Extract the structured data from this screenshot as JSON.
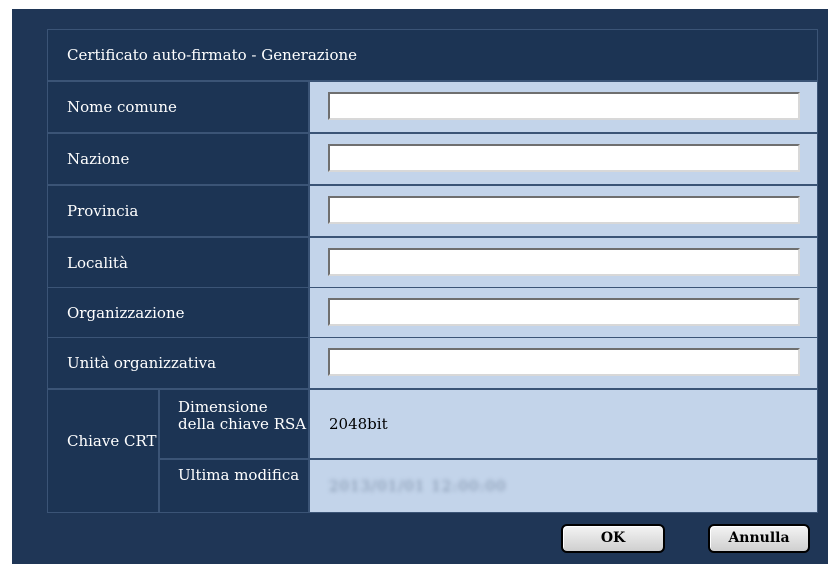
{
  "dialog": {
    "title": "Certificato auto-firmato - Generazione"
  },
  "fields": [
    {
      "label": "Nome comune",
      "value": ""
    },
    {
      "label": "Nazione",
      "value": ""
    },
    {
      "label": "Provincia",
      "value": ""
    },
    {
      "label": "Località",
      "value": ""
    },
    {
      "label": "Organizzazione",
      "value": ""
    },
    {
      "label": "Unità organizzativa",
      "value": ""
    }
  ],
  "crt": {
    "label": "Chiave CRT",
    "key_size_label": "Dimensione della chiave RSA",
    "key_size_value": "2048bit",
    "last_modified_label": "Ultima modifica",
    "last_modified_value": "2013/01/01 12:00:00"
  },
  "buttons": {
    "ok": "OK",
    "cancel": "Annulla"
  }
}
